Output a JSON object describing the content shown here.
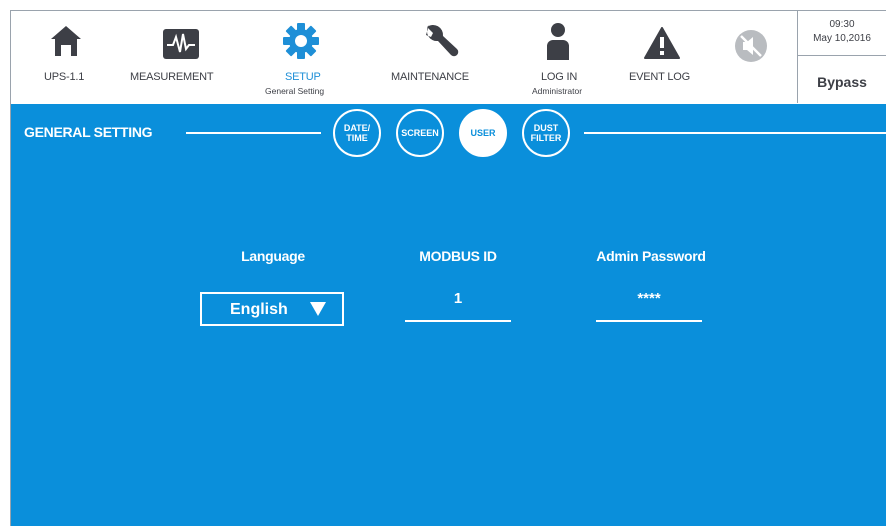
{
  "nav": {
    "home": {
      "label": "UPS-1.1",
      "icon": "home-icon"
    },
    "measurement": {
      "label": "MEASUREMENT",
      "icon": "waveform-icon"
    },
    "setup": {
      "label": "SETUP",
      "sub": "General Setting",
      "icon": "gear-icon"
    },
    "maintenance": {
      "label": "MAINTENANCE",
      "icon": "wrench-icon"
    },
    "login": {
      "label": "LOG IN",
      "sub": "Administrator",
      "icon": "user-icon"
    },
    "eventlog": {
      "label": "EVENT LOG",
      "icon": "warning-icon"
    },
    "mute": {
      "icon": "mute-icon"
    }
  },
  "status": {
    "time": "09:30",
    "date": "May 10,2016",
    "mode": "Bypass"
  },
  "panel": {
    "title": "GENERAL SETTING",
    "tabs": [
      {
        "line1": "DATE/",
        "line2": "TIME"
      },
      {
        "line1": "SCREEN",
        "line2": ""
      },
      {
        "line1": "USER",
        "line2": ""
      },
      {
        "line1": "DUST",
        "line2": "FILTER"
      }
    ],
    "active_tab": "USER"
  },
  "form": {
    "language_label": "Language",
    "language_value": "English",
    "modbus_label": "MODBUS ID",
    "modbus_value": "1",
    "password_label": "Admin Password",
    "password_value": "****"
  },
  "colors": {
    "accent": "#0a8fdb",
    "active_nav": "#1e8fd7",
    "nav_text": "#3d3f46",
    "icon_dark": "#3d3f46"
  }
}
